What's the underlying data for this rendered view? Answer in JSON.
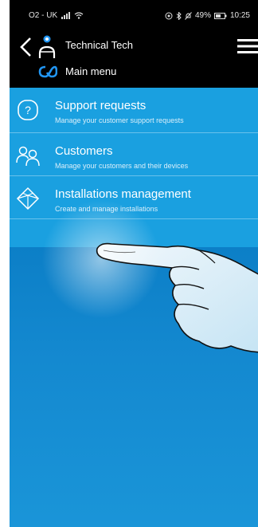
{
  "status_bar": {
    "carrier": "O2 - UK",
    "battery": "49%",
    "time": "10:25"
  },
  "app_bar": {
    "title": "Technical Tech",
    "subtitle": "Main menu"
  },
  "menu": {
    "items": [
      {
        "title": "Support requests",
        "description": "Manage your customer support requests",
        "icon": "help-circle-icon"
      },
      {
        "title": "Customers",
        "description": "Manage your customers and their devices",
        "icon": "users-icon"
      },
      {
        "title": "Installations management",
        "description": "Create and manage installations",
        "icon": "cube-icon"
      }
    ]
  },
  "colors": {
    "accent": "#1aa0e0",
    "header": "#000000",
    "logo": "#2196f3"
  }
}
